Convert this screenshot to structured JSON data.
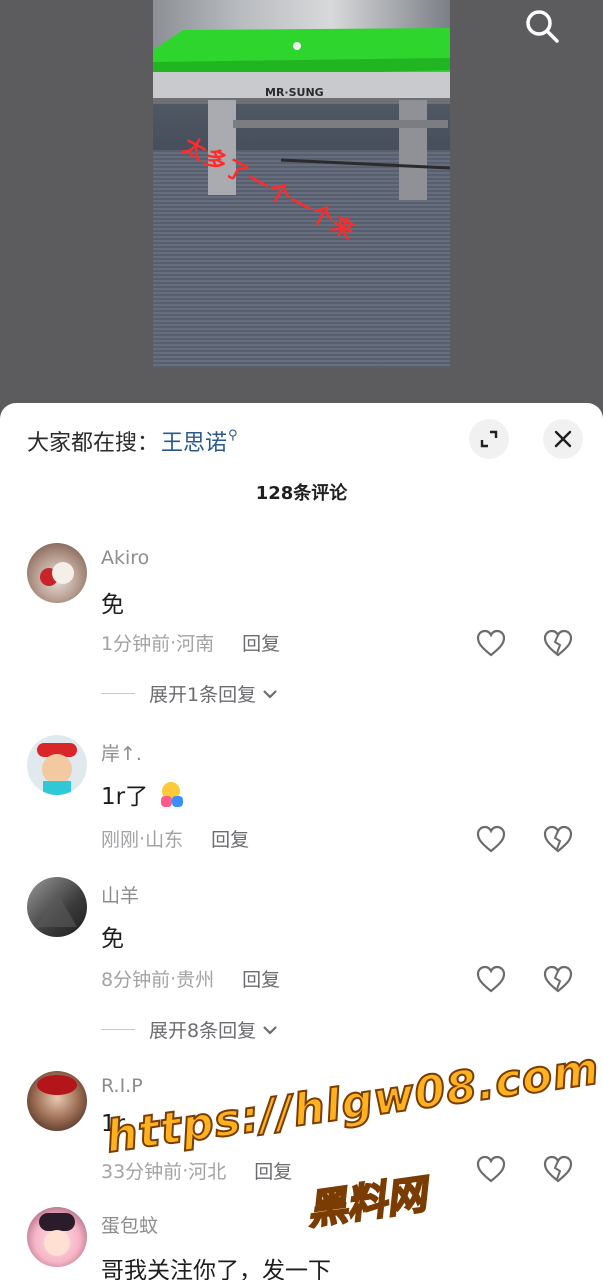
{
  "video": {
    "overlay_text": "太多了一个一个来",
    "table_brand": "MR·SUNG"
  },
  "header": {
    "hot_search_label": "大家都在搜：",
    "hot_search_keyword": "王思诺",
    "comment_count": "128条评论"
  },
  "comments": [
    {
      "username": "Akiro",
      "text": "免",
      "time": "1分钟前",
      "location": "河南",
      "reply_label": "回复",
      "expand_label": "展开1条回复"
    },
    {
      "username": "岸↑.",
      "text": "1r了",
      "time": "刚刚",
      "location": "山东",
      "reply_label": "回复"
    },
    {
      "username": "山羊",
      "text": "免",
      "time": "8分钟前",
      "location": "贵州",
      "reply_label": "回复",
      "expand_label": "展开8条回复"
    },
    {
      "username": "R.I.P",
      "text": "1r",
      "time": "33分钟前",
      "location": "河北",
      "reply_label": "回复"
    },
    {
      "username": "蛋包蚊",
      "text": "哥我关注你了，发一下"
    }
  ],
  "meta_separator": " · ",
  "watermark": {
    "url": "https://hlgw08.com",
    "name": "黑料网"
  },
  "colors": {
    "sheet_bg": "#ffffff",
    "keyword": "#2a5a8c",
    "meta_text": "#a3a3a6",
    "watermark": "#ffb21f"
  }
}
